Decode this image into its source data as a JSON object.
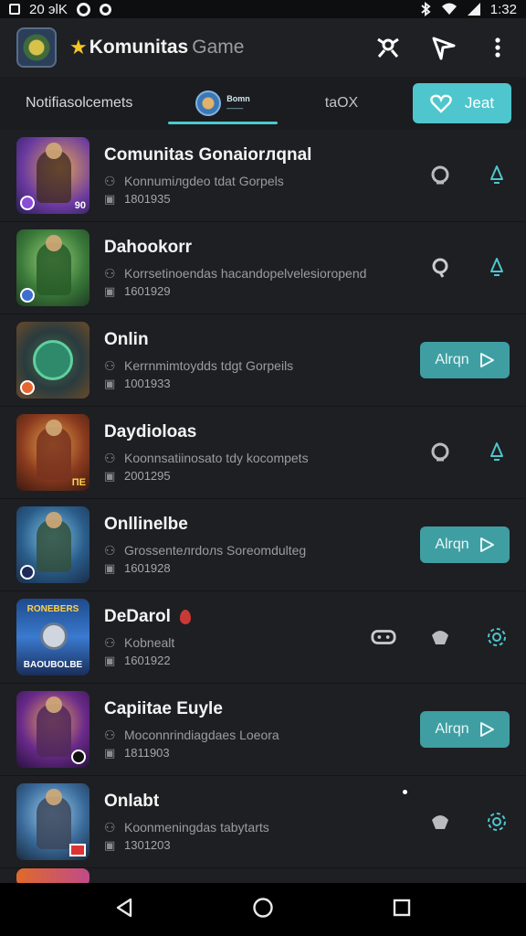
{
  "status_bar": {
    "left_text": "20 эlK",
    "time": "1:32"
  },
  "app_bar": {
    "title": "Komunitas",
    "title_suffix": "Game"
  },
  "tabs": [
    {
      "label": "Notifiasolcemets"
    },
    {
      "badge_top": "Bomn",
      "badge_bottom": "——"
    },
    {
      "label": "tаOX"
    }
  ],
  "join_button": {
    "label": "Jeat"
  },
  "colors": {
    "accent": "#4fc6cd",
    "action_teal": "#3f9ea2",
    "background": "#1e1f22"
  },
  "communities": [
    {
      "title": "Comunitas Gonaiorлqnal",
      "subtitle": "Konnumiлgdeo tdat Gorpels",
      "meta": "1801935",
      "thumb_text": "90",
      "actions": [
        "chat-icon",
        "bell-icon"
      ],
      "button": ""
    },
    {
      "title": "Dahookorr",
      "subtitle": "Korrsetinoendas hacandopelvelesioropend",
      "meta": "1601929",
      "thumb_text": "",
      "actions": [
        "location-icon",
        "bell-icon"
      ],
      "button": ""
    },
    {
      "title": "Onlin",
      "subtitle": "Kerrnmimtoydds tdgt Gorpeils",
      "meta": "1001933",
      "thumb_text": "",
      "actions": [],
      "button": "Alrqn"
    },
    {
      "title": "Daydioloas",
      "subtitle": "Koonnsatiinosato tdy kocompets",
      "meta": "2001295",
      "thumb_text": "ПЕ",
      "actions": [
        "chat-icon",
        "bell-icon"
      ],
      "button": ""
    },
    {
      "title": "Onllinelbe",
      "subtitle": "Grossenteлrdoлs Soreomdulteg",
      "meta": "1601928",
      "thumb_text": "",
      "actions": [],
      "button": "Alrqn"
    },
    {
      "title": "DeDarol",
      "subtitle": "Kobnealt",
      "meta": "1601922",
      "thumb_text": "",
      "banner_top": "RONEBERS",
      "banner_bottom": "BAOUBOLBE",
      "actions": [
        "gamepad-icon",
        "chat-icon",
        "settings-icon"
      ],
      "button": ""
    },
    {
      "title": "Capiitae Euyle",
      "subtitle": "Moconnrindiagdaes Loeora",
      "meta": "1811903",
      "thumb_text": "",
      "actions": [],
      "button": "Alrqn"
    },
    {
      "title": "Onlabt",
      "subtitle": "Koonmeningdas tabytarts",
      "meta": "1301203",
      "thumb_text": "",
      "actions": [
        "chat-icon",
        "settings-icon"
      ],
      "button": ""
    }
  ]
}
